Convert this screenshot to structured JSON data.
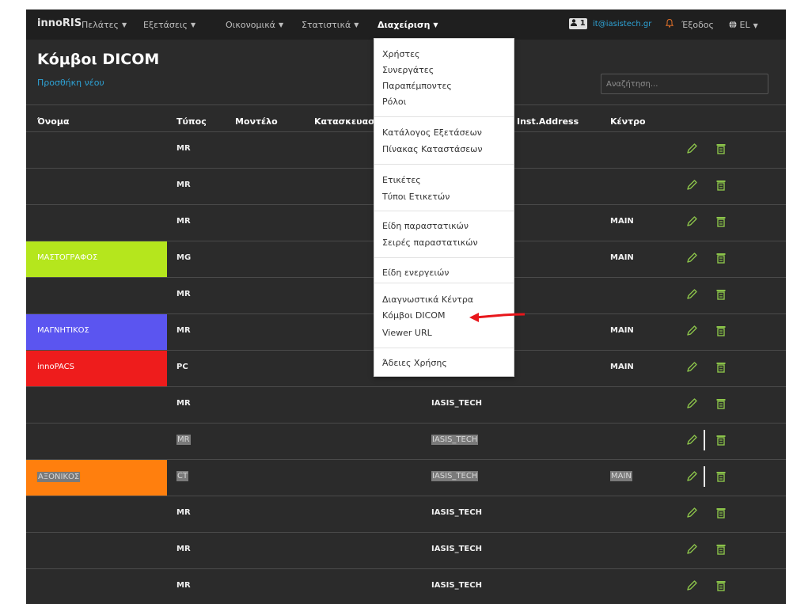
{
  "navbar": {
    "brand": "innoRIS",
    "menu": [
      {
        "label": "Πελάτες"
      },
      {
        "label": "Εξετάσεις"
      },
      {
        "label": "Οικονομικά"
      },
      {
        "label": "Στατιστικά"
      },
      {
        "label": "Διαχείριση"
      }
    ],
    "user_badge": "1",
    "email": "it@iasistech.gr",
    "logout": "Έξοδος",
    "lang": "EL"
  },
  "page": {
    "title": "Κόμβοι DICOM",
    "add_new": "Προσθήκη νέου",
    "search_placeholder": "Αναζήτηση..."
  },
  "table": {
    "headers": {
      "name": "Όνομα",
      "type": "Τύπος",
      "model": "Μοντέλο",
      "manufacturer": "Κατασκευασ",
      "inst_address": "Inst.Address",
      "center": "Κέντρο"
    },
    "rows": [
      {
        "name": "",
        "type": "MR",
        "inst": "",
        "center": "",
        "color": ""
      },
      {
        "name": "",
        "type": "MR",
        "inst": "",
        "center": "",
        "color": ""
      },
      {
        "name": "",
        "type": "MR",
        "inst": "",
        "center": "MAIN",
        "color": ""
      },
      {
        "name": "ΜΑΣΤΟΓΡΑΦΟΣ",
        "type": "MG",
        "inst": "",
        "center": "MAIN",
        "color": "#b5e61d"
      },
      {
        "name": "",
        "type": "MR",
        "inst": "",
        "center": "",
        "color": ""
      },
      {
        "name": "ΜΑΓΝΗΤΙΚΟΣ",
        "type": "MR",
        "inst": "",
        "center": "MAIN",
        "color": "#5b55f0"
      },
      {
        "name": "innoPACS",
        "type": "PC",
        "inst": "",
        "center": "MAIN",
        "color": "#ee1c1c"
      },
      {
        "name": "",
        "type": "MR",
        "inst": "IASIS_TECH",
        "center": "",
        "color": ""
      },
      {
        "name": "",
        "type": "MR",
        "inst": "IASIS_TECH",
        "center": "",
        "color": ""
      },
      {
        "name": "ΑΞΟΝΙΚΟΣ",
        "type": "CT",
        "inst": "IASIS_TECH",
        "center": "MAIN",
        "color": "#ff7f0e"
      },
      {
        "name": "",
        "type": "MR",
        "inst": "IASIS_TECH",
        "center": "",
        "color": ""
      },
      {
        "name": "",
        "type": "MR",
        "inst": "IASIS_TECH",
        "center": "",
        "color": ""
      },
      {
        "name": "",
        "type": "MR",
        "inst": "IASIS_TECH",
        "center": "",
        "color": ""
      }
    ]
  },
  "dropdown": {
    "items": [
      "Χρήστες",
      "Συνεργάτες",
      "Παραπέμποντες",
      "Ρόλοι",
      "Κατάλογος Εξετάσεων",
      "Πίνακας Καταστάσεων",
      "Ετικέτες",
      "Τύποι Ετικετών",
      "Είδη παραστατικών",
      "Σειρές παραστατικών",
      "Είδη ενεργειών",
      "Διαγνωστικά Κέντρα",
      "Κόμβοι DICOM",
      "Viewer URL",
      "Άδειες Χρήσης"
    ]
  },
  "colors": {
    "accent": "#2ea3d6",
    "icon": "#8bc34a",
    "annotation_arrow": "#e8161b"
  },
  "icons": {
    "edit": "pencil-icon",
    "delete": "trash-icon",
    "user": "user-badge-icon",
    "bell": "bell-icon",
    "globe": "globe-icon"
  }
}
